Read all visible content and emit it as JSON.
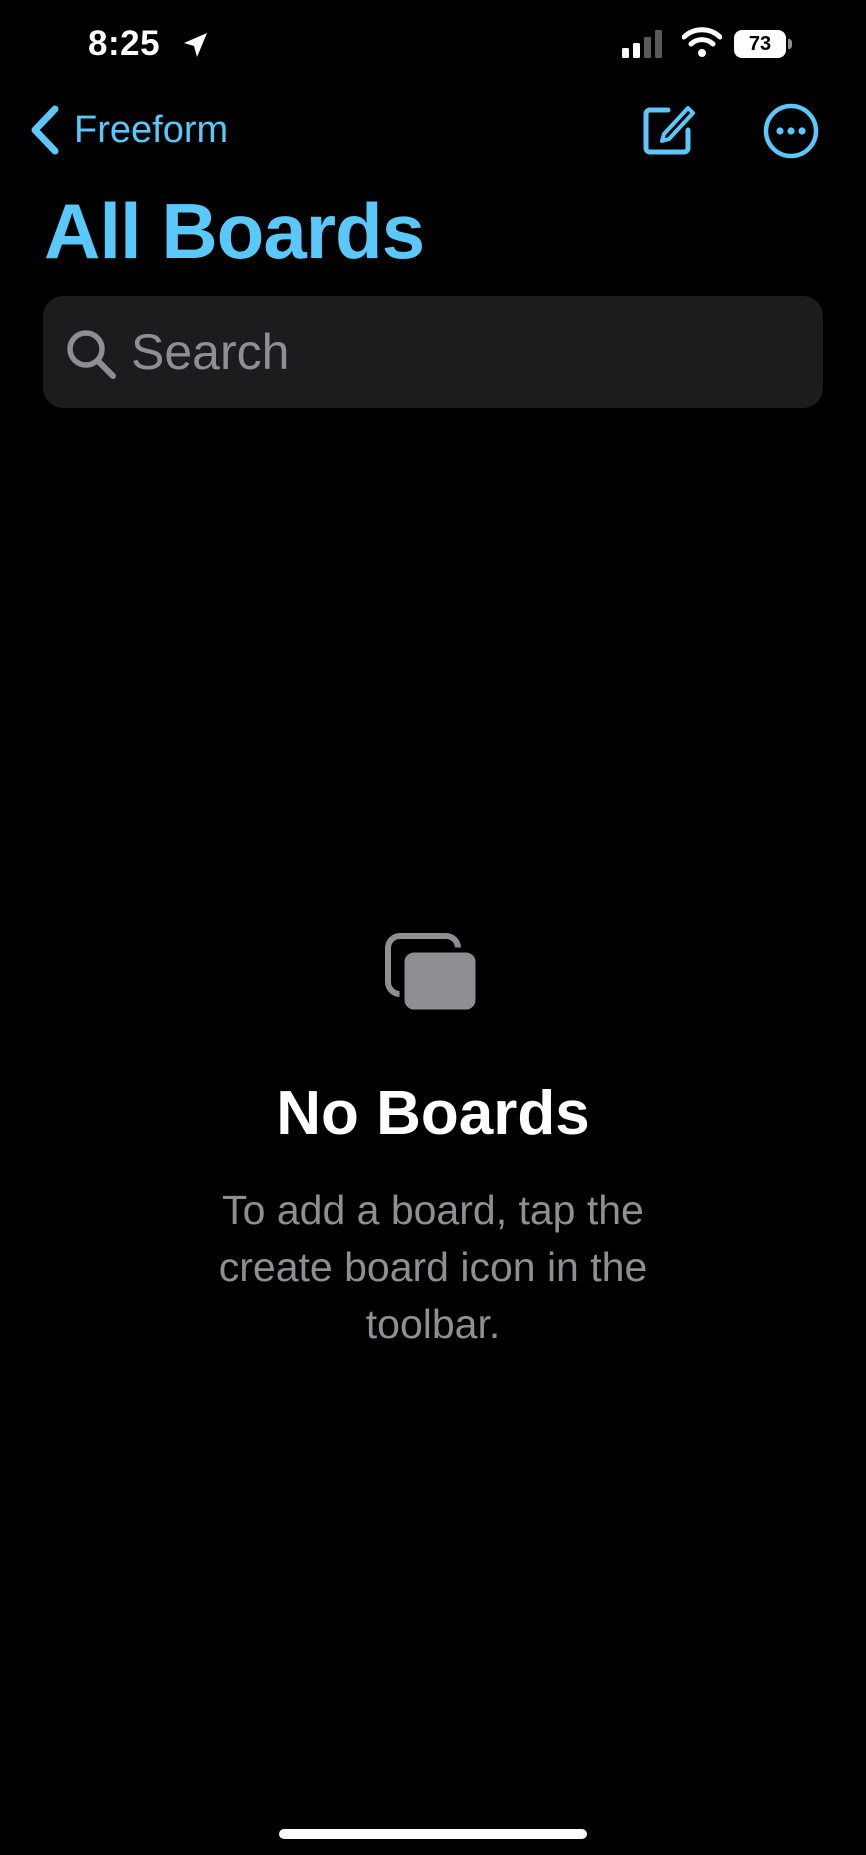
{
  "status_bar": {
    "time": "8:25",
    "battery_level": "73",
    "icons": [
      "location-arrow-icon",
      "cellular-signal-icon",
      "wifi-icon",
      "battery-icon"
    ]
  },
  "nav": {
    "back_label": "Freeform",
    "back_icon": "chevron-left-icon",
    "actions": [
      "compose-icon",
      "more-ellipsis-icon"
    ]
  },
  "page": {
    "title": "All Boards"
  },
  "search": {
    "placeholder": "Search",
    "value": "",
    "icon": "search-icon"
  },
  "empty_state": {
    "icon": "stacked-boards-icon",
    "title": "No Boards",
    "message": "To add a board, tap the create board icon in the toolbar."
  },
  "colors": {
    "accent": "#5ac8fa",
    "background": "#000000",
    "search_background": "#1c1c1e",
    "secondary_text": "#8e8e93",
    "empty_icon": "#8e8e93"
  }
}
